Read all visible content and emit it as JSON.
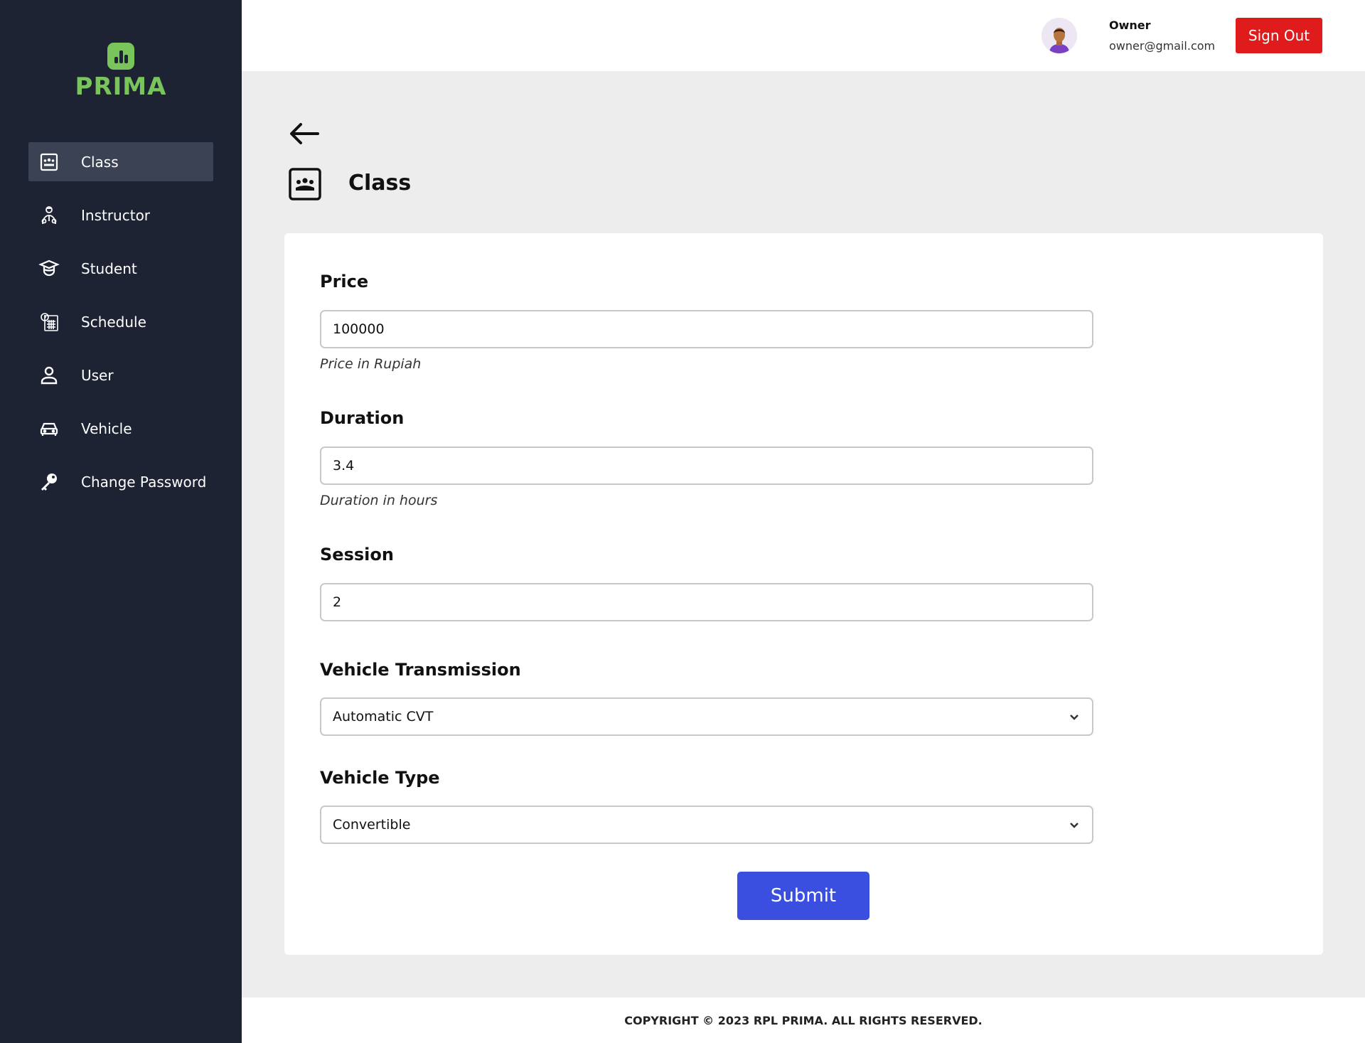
{
  "app": {
    "logo_text": "PRIMA"
  },
  "sidebar": {
    "items": [
      {
        "label": "Class",
        "icon": "class-icon",
        "active": true
      },
      {
        "label": "Instructor",
        "icon": "instructor-icon"
      },
      {
        "label": "Student",
        "icon": "student-icon"
      },
      {
        "label": "Schedule",
        "icon": "schedule-icon"
      },
      {
        "label": "User",
        "icon": "user-icon"
      },
      {
        "label": "Vehicle",
        "icon": "vehicle-icon"
      },
      {
        "label": "Change Password",
        "icon": "key-icon"
      }
    ]
  },
  "header": {
    "user_name": "Owner",
    "user_email": "owner@gmail.com",
    "signout_label": "Sign Out"
  },
  "page": {
    "title": "Class"
  },
  "form": {
    "price": {
      "label": "Price",
      "value": "100000",
      "help": "Price in Rupiah"
    },
    "duration": {
      "label": "Duration",
      "value": "3.4",
      "help": "Duration in hours"
    },
    "session": {
      "label": "Session",
      "value": "2"
    },
    "transmission": {
      "label": "Vehicle Transmission",
      "selected": "Automatic CVT"
    },
    "vehicle_type": {
      "label": "Vehicle Type",
      "selected": "Convertible"
    },
    "submit_label": "Submit"
  },
  "footer": {
    "text": "COPYRIGHT © 2023 RPL PRIMA. ALL RIGHTS RESERVED."
  },
  "colors": {
    "sidebar": "#1e2333",
    "accent_green": "#7ac45c",
    "signout_red": "#e01b1b",
    "submit_blue": "#3a4fe0"
  }
}
